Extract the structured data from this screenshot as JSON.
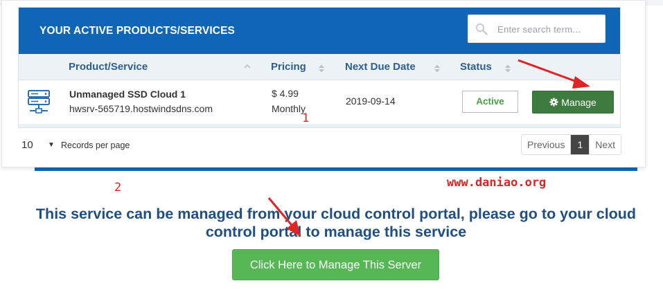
{
  "panel": {
    "title": "YOUR ACTIVE PRODUCTS/SERVICES",
    "search": {
      "placeholder": "Enter search term..."
    }
  },
  "table": {
    "columns": [
      "Product/Service",
      "Pricing",
      "Next Due Date",
      "Status"
    ],
    "rows": [
      {
        "icon": "server-icon",
        "product_name": "Unmanaged SSD Cloud 1",
        "hostname": "hwsrv-565719.hostwindsdns.com",
        "price": "$ 4.99",
        "billing_cycle": "Monthly",
        "next_due_date": "2019-09-14",
        "status": "Active",
        "action_label": "Manage"
      }
    ]
  },
  "pager": {
    "page_size": "10",
    "records_label": "Records per page",
    "previous_label": "Previous",
    "current_page": "1",
    "next_label": "Next"
  },
  "annotations": {
    "step1": "1",
    "step2": "2",
    "watermark": "www.daniao.org",
    "arrow_color": "#e02424"
  },
  "message": "This service can be managed from your cloud control portal, please go to your cloud control portal to manage this service",
  "cta_button": "Click Here to Manage This Server",
  "colors": {
    "header_blue": "#0f66b6",
    "column_header_text": "#2d5e93",
    "manage_green": "#3d7b3e",
    "cta_green": "#55b855",
    "active_text": "#46a046",
    "message_text": "#1f4f82"
  }
}
